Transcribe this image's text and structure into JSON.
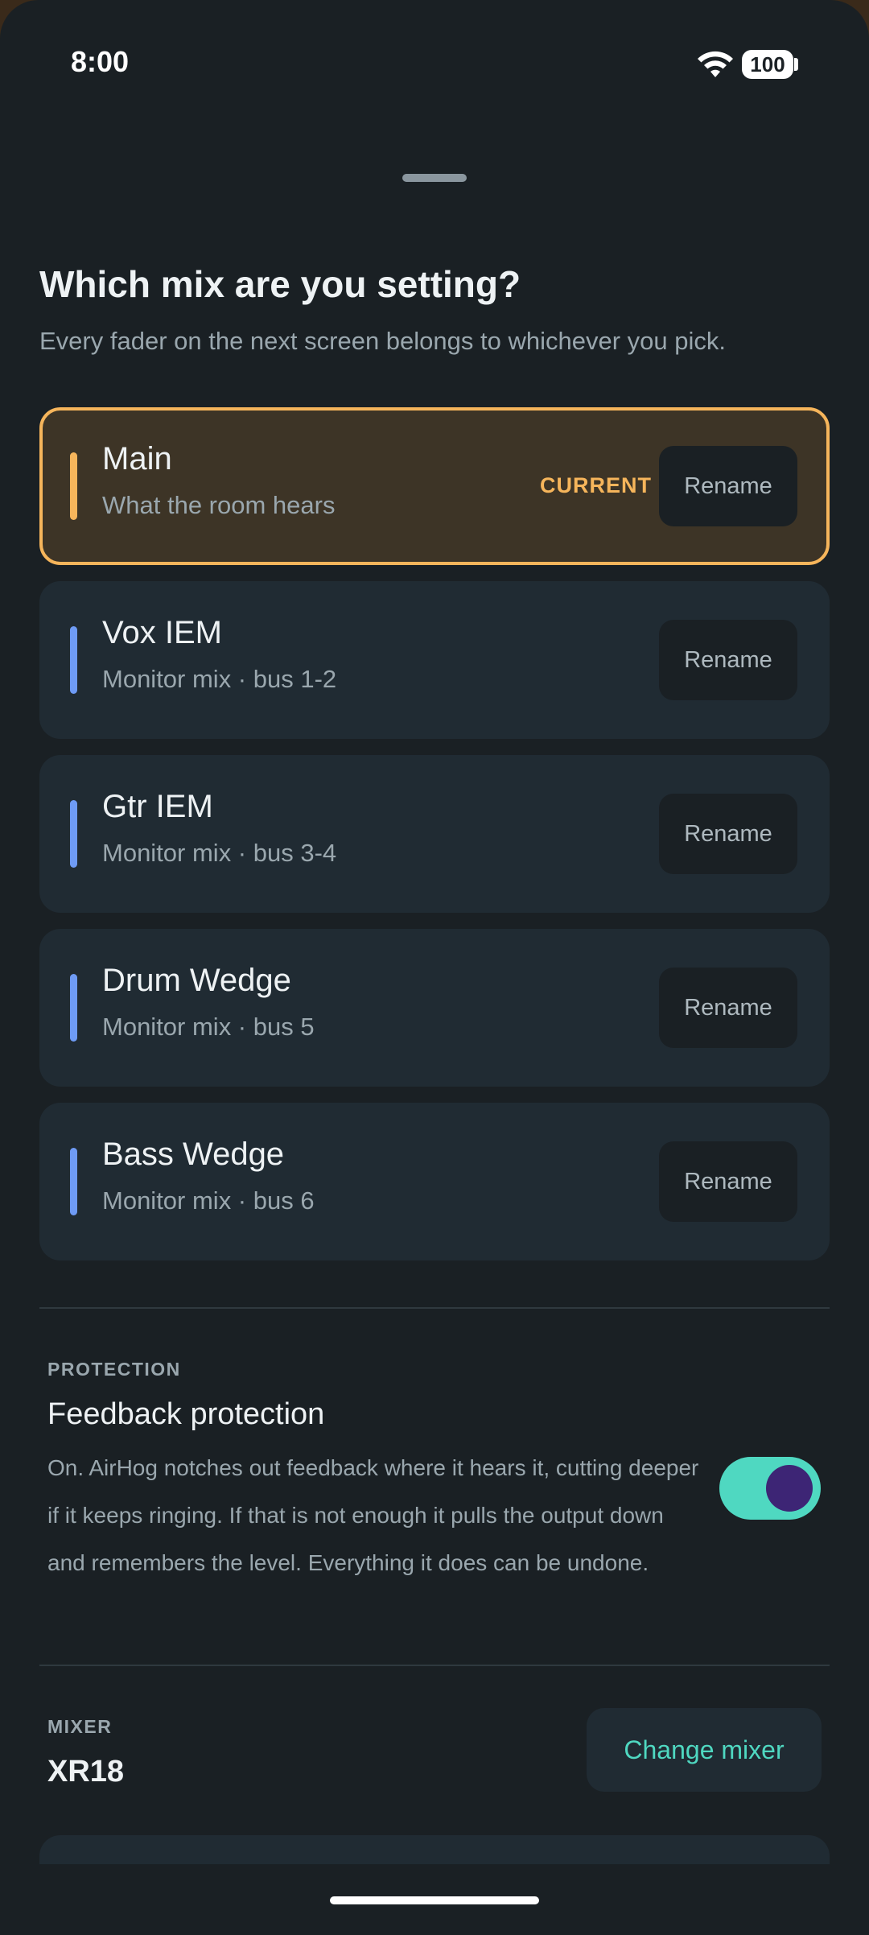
{
  "status_bar": {
    "time": "8:00",
    "battery": "100"
  },
  "header": {
    "title": "Which mix are you setting?",
    "subtitle": "Every fader on the next screen belongs to whichever you pick."
  },
  "mixes": [
    {
      "name": "Main",
      "description": "What the room hears",
      "badge": "CURRENT",
      "rename_label": "Rename",
      "current": true,
      "accent_color": "#f6b55b"
    },
    {
      "name": "Vox IEM",
      "description": "Monitor mix · bus 1-2",
      "rename_label": "Rename",
      "accent_color": "#6e9bf5"
    },
    {
      "name": "Gtr IEM",
      "description": "Monitor mix · bus 3-4",
      "rename_label": "Rename",
      "accent_color": "#6e9bf5"
    },
    {
      "name": "Drum Wedge",
      "description": "Monitor mix · bus 5",
      "rename_label": "Rename",
      "accent_color": "#6e9bf5"
    },
    {
      "name": "Bass Wedge",
      "description": "Monitor mix · bus 6",
      "rename_label": "Rename",
      "accent_color": "#6e9bf5"
    }
  ],
  "protection": {
    "label": "PROTECTION",
    "title": "Feedback protection",
    "body": "On. AirHog notches out feedback where it hears it, cutting deeper if it keeps ringing. If that is not enough it pulls the output down and remembers the level. Everything it does can be undone.",
    "enabled": true
  },
  "mixer": {
    "label": "MIXER",
    "name": "XR18",
    "change_label": "Change mixer"
  },
  "colors": {
    "background": "#1a2024",
    "card": "#202b33",
    "current_accent": "#f6b55b",
    "monitor_accent": "#6e9bf5",
    "teal": "#4fd8c1"
  }
}
